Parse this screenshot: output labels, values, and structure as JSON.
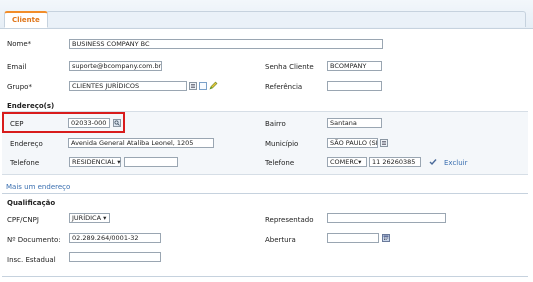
{
  "tab": {
    "label": "Cliente"
  },
  "form": {
    "nome_label": "Nome*",
    "nome_value": "BUSINESS COMPANY BC",
    "email_label": "Email",
    "email_value": "suporte@bcompany.com.br",
    "senha_label": "Senha Cliente",
    "senha_value": "BCOMPANY",
    "grupo_label": "Grupo*",
    "grupo_value": "CLIENTES JURÍDICOS",
    "referencia_label": "Referência",
    "referencia_value": ""
  },
  "endereco": {
    "title": "Endereço(s)",
    "cep_label": "CEP",
    "cep_value": "02033-000",
    "bairro_label": "Bairro",
    "bairro_value": "Santana",
    "endereco_label": "Endereço",
    "endereco_value": "Avenida General Ataliba Leonel, 1205",
    "municipio_label": "Município",
    "municipio_value": "SÃO PAULO (SP)",
    "telefone1_label": "Telefone",
    "telefone1_type": "RESIDENCIAL",
    "telefone1_value": "",
    "telefone2_label": "Telefone",
    "telefone2_type": "COMERC",
    "telefone2_value": "11 26260385",
    "excluir_label": "Excluir",
    "mais_label": "Mais um endereço"
  },
  "qualificacao": {
    "title": "Qualificação",
    "cpfcnpj_label": "CPF/CNPJ",
    "cpfcnpj_value": "JURÍDICA",
    "documento_label": "Nº Documento:",
    "documento_value": "02.289.264/0001-32",
    "inscricao_label": "Insc. Estadual",
    "inscricao_value": "",
    "representado_label": "Representado",
    "representado_value": "",
    "abertura_label": "Abertura",
    "abertura_value": ""
  },
  "colors": {
    "accent": "#e0761a",
    "highlight": "#d81c1c",
    "link": "#3a6fb0"
  }
}
